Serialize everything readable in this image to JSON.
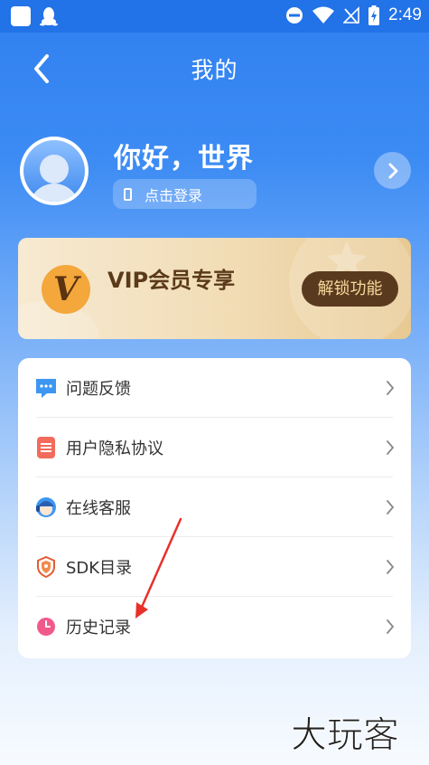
{
  "status_bar": {
    "time": "2:49"
  },
  "header": {
    "title": "我的"
  },
  "profile": {
    "greeting": "你好，世界",
    "login_label": "点击登录"
  },
  "vip": {
    "badge_letter": "V",
    "title": "VIP会员专享",
    "unlock_label": "解锁功能"
  },
  "menu": {
    "items": [
      {
        "label": "问题反馈",
        "icon": "feedback-icon"
      },
      {
        "label": "用户隐私协议",
        "icon": "privacy-doc-icon"
      },
      {
        "label": "在线客服",
        "icon": "customer-service-icon"
      },
      {
        "label": "SDK目录",
        "icon": "sdk-shield-icon"
      },
      {
        "label": "历史记录",
        "icon": "clock-icon"
      }
    ]
  },
  "colors": {
    "primary_blue": "#2272e8",
    "vip_gold": "#f4a73b",
    "vip_brown": "#5a3a1e",
    "annotation_red": "#e8302a"
  },
  "watermark": {
    "text": "大玩客"
  }
}
